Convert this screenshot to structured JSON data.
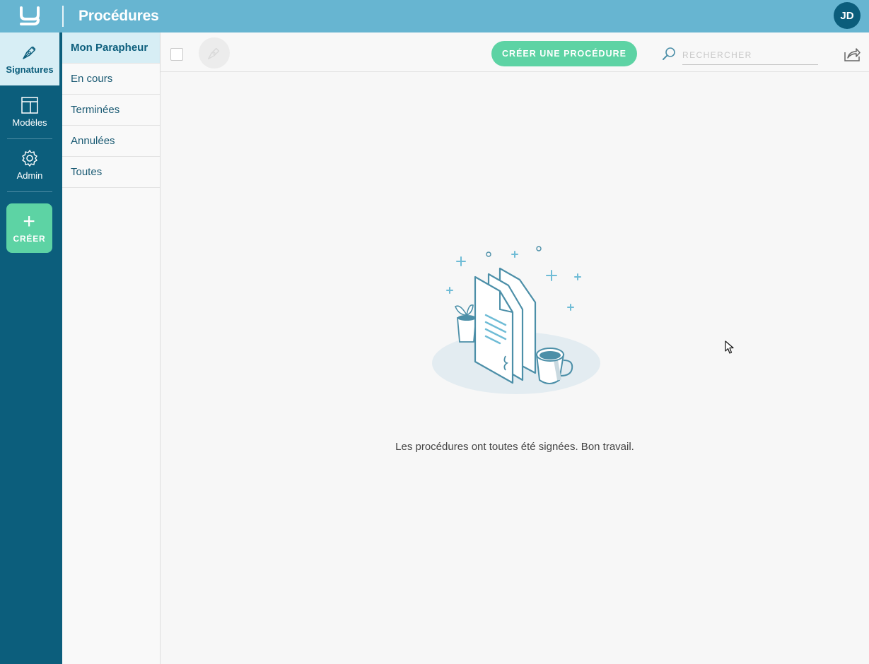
{
  "header": {
    "app_title": "Procédures",
    "avatar_initials": "JD"
  },
  "rail": {
    "items": [
      {
        "label": "Signatures",
        "icon": "pen-nib-icon",
        "active": true
      },
      {
        "label": "Modèles",
        "icon": "layout-template-icon",
        "active": false
      },
      {
        "label": "Admin",
        "icon": "gear-icon",
        "active": false
      }
    ],
    "create_label": "CRÉER"
  },
  "subnav": {
    "items": [
      {
        "label": "Mon Parapheur",
        "active": true
      },
      {
        "label": "En cours",
        "active": false
      },
      {
        "label": "Terminées",
        "active": false
      },
      {
        "label": "Annulées",
        "active": false
      },
      {
        "label": "Toutes",
        "active": false
      }
    ]
  },
  "toolbar": {
    "create_procedure_label": "CRÉER UNE PROCÉDURE",
    "search_placeholder": "RECHERCHER"
  },
  "content": {
    "empty_message": "Les procédures ont toutes été signées. Bon travail."
  },
  "colors": {
    "topbar": "#67b5d1",
    "rail": "#0c5e7c",
    "accent_green": "#5dd3a4",
    "active_bg": "#d7eef5"
  }
}
